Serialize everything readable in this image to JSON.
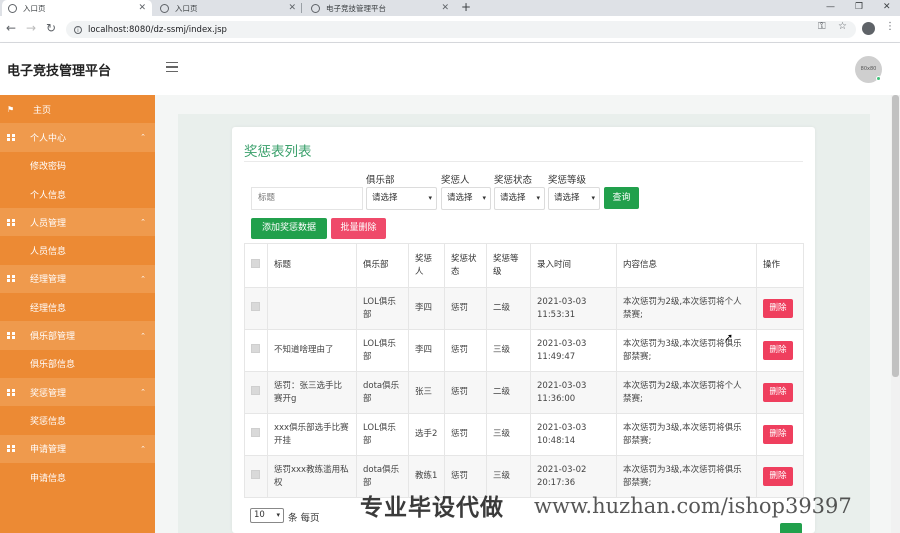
{
  "browser": {
    "tabs": [
      {
        "title": "入口页",
        "active": true
      },
      {
        "title": "入口页",
        "active": false
      },
      {
        "title": "电子竞技管理平台",
        "active": false
      }
    ],
    "new_tab": "+",
    "url": "localhost:8080/dz-ssmj/index.jsp"
  },
  "app": {
    "title": "电子竞技管理平台",
    "avatar_text": "80x80"
  },
  "sidebar": {
    "items": [
      {
        "label": "主页",
        "type": "top",
        "icon": "flag-icon"
      },
      {
        "label": "个人中心",
        "type": "group",
        "icon": "grid-icon"
      },
      {
        "label": "修改密码",
        "type": "sub"
      },
      {
        "label": "个人信息",
        "type": "sub"
      },
      {
        "label": "人员管理",
        "type": "group",
        "icon": "grid-icon"
      },
      {
        "label": "人员信息",
        "type": "sub"
      },
      {
        "label": "经理管理",
        "type": "group",
        "icon": "grid-icon"
      },
      {
        "label": "经理信息",
        "type": "sub"
      },
      {
        "label": "俱乐部管理",
        "type": "group",
        "icon": "grid-icon"
      },
      {
        "label": "俱乐部信息",
        "type": "sub"
      },
      {
        "label": "奖惩管理",
        "type": "group",
        "icon": "grid-icon"
      },
      {
        "label": "奖惩信息",
        "type": "sub"
      },
      {
        "label": "申请管理",
        "type": "group",
        "icon": "grid-icon"
      },
      {
        "label": "申请信息",
        "type": "sub"
      }
    ]
  },
  "page": {
    "title": "奖惩表列表",
    "filters": {
      "title_placeholder": "标题",
      "club_label": "俱乐部",
      "club_value": "请选择",
      "person_label": "奖惩人",
      "person_value": "请选择",
      "status_label": "奖惩状态",
      "status_value": "请选择",
      "level_label": "奖惩等级",
      "level_value": "请选择",
      "query_button": "查询"
    },
    "actions": {
      "add_button": "添加奖惩数据",
      "batch_delete_button": "批量删除"
    },
    "table": {
      "headers": [
        "标题",
        "俱乐部",
        "奖惩人",
        "奖惩状态",
        "奖惩等级",
        "录入时间",
        "内容信息",
        "操作"
      ],
      "rows": [
        {
          "title": "",
          "club": "LOL俱乐部",
          "person": "李四",
          "status": "惩罚",
          "level": "二级",
          "time": "2021-03-03 11:53:31",
          "content": "本次惩罚为2级,本次惩罚将个人禁赛;",
          "action": "删除"
        },
        {
          "title": "不知道啥理由了",
          "club": "LOL俱乐部",
          "person": "李四",
          "status": "惩罚",
          "level": "三级",
          "time": "2021-03-03 11:49:47",
          "content": "本次惩罚为3级,本次惩罚将俱乐部禁赛;",
          "action": "删除"
        },
        {
          "title": "惩罚：张三选手比赛开g",
          "club": "dota俱乐部",
          "person": "张三",
          "status": "惩罚",
          "level": "二级",
          "time": "2021-03-03 11:36:00",
          "content": "本次惩罚为2级,本次惩罚将个人禁赛;",
          "action": "删除"
        },
        {
          "title": "xxx俱乐部选手比赛开挂",
          "club": "LOL俱乐部",
          "person": "选手2",
          "status": "惩罚",
          "level": "三级",
          "time": "2021-03-03 10:48:14",
          "content": "本次惩罚为3级,本次惩罚将俱乐部禁赛;",
          "action": "删除"
        },
        {
          "title": "惩罚xxx教练滥用私权",
          "club": "dota俱乐部",
          "person": "教练1",
          "status": "惩罚",
          "level": "三级",
          "time": "2021-03-02 20:17:36",
          "content": "本次惩罚为3级,本次惩罚将俱乐部禁赛;",
          "action": "删除"
        }
      ]
    },
    "pagination": {
      "page_size": "10",
      "per_page_label": "条 每页"
    }
  },
  "watermark": {
    "text": "专业毕设代做",
    "url": "www.huzhan.com/ishop39397"
  },
  "colors": {
    "sidebar": "#ec8a34",
    "accent_green": "#21a04c",
    "danger": "#ef3f5e",
    "title_green": "#3aa06b"
  }
}
